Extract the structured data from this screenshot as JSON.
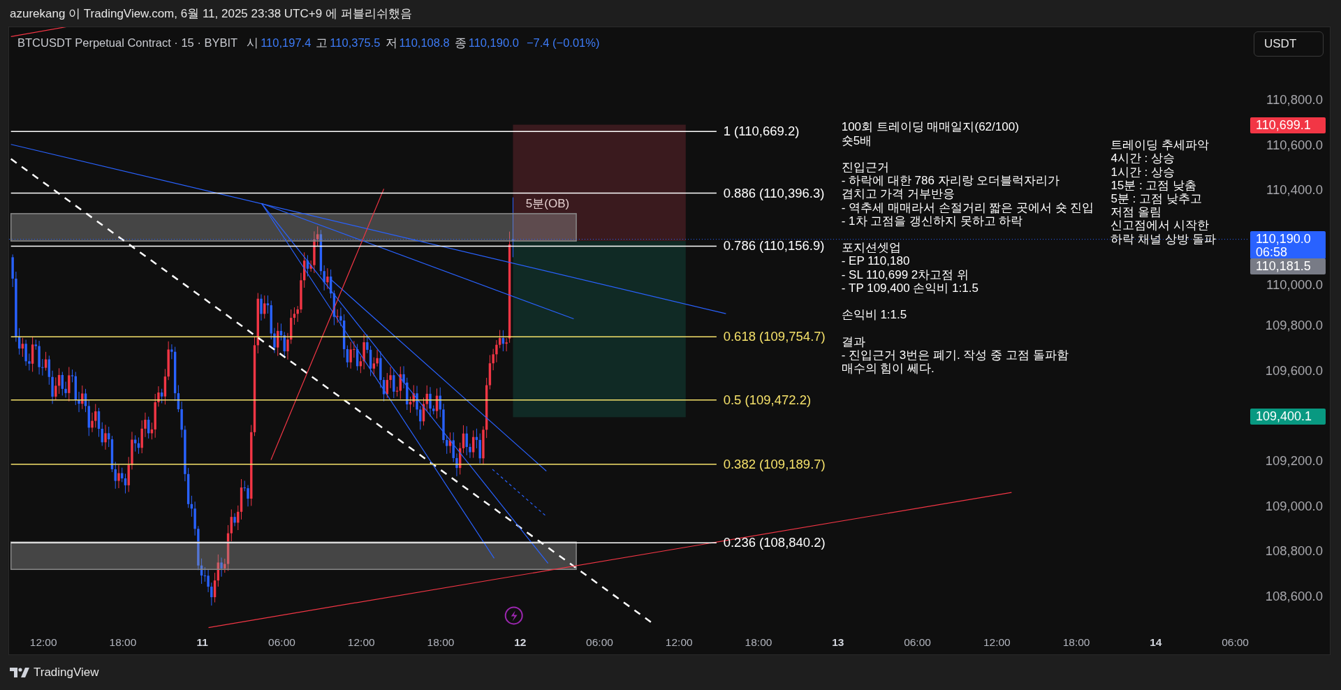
{
  "header": {
    "text": "azurekang 이 TradingView.com, 6월 11, 2025 23:38 UTC+9 에 퍼블리쉬했음"
  },
  "legend": {
    "symbol": "BTCUSDT Perpetual Contract · 15 · BYBIT",
    "fields": [
      {
        "label": "시",
        "value": "110,197.4"
      },
      {
        "label": "고",
        "value": "110,375.5"
      },
      {
        "label": "저",
        "value": "110,108.8"
      },
      {
        "label": "종",
        "value": "110,190.0"
      }
    ],
    "change": "−7.4 (−0.01%)"
  },
  "currency_button": "USDT",
  "fib_levels": [
    {
      "label": "1 (110,669.2)",
      "color": "#ffffff"
    },
    {
      "label": "0.886 (110,396.3)",
      "color": "#ffffff"
    },
    {
      "label": "0.786 (110,156.9)",
      "color": "#ffffff"
    },
    {
      "label": "0.618 (109,754.7)",
      "color": "#f5e16a"
    },
    {
      "label": "0.5 (109,472.2)",
      "color": "#f5e16a"
    },
    {
      "label": "0.382 (109,189.7)",
      "color": "#f5e16a"
    },
    {
      "label": "0.236 (108,840.2)",
      "color": "#ffffff"
    }
  ],
  "zone_label": "5분(OB)",
  "notes": [
    {
      "text": "100회 트레이딩 매매일지(62/100)\n숏5배\n\n진입근거\n- 하락에 대한 786 자리랑 오더블럭자리가\n겹치고 가격 거부반응\n- 역추세 매매라서 손절거리 짧은 곳에서 숏 진입\n- 1차 고점을 갱신하지 못하고 하락\n\n포지션셋업\n- EP 110,180\n- SL 110,699 2차고점 위\n- TP 109,400 손익비 1:1.5\n\n손익비 1:1.5\n\n결과\n- 진입근거 3번은 폐기. 작성 중 고점 돌파함\n매수의 힘이 쎄다."
    },
    {
      "text": "트레이딩 추세파악\n4시간 : 상승\n1시간 : 상승\n15분 : 고점 낮춤\n5분 : 고점 낮추고\n저점 올림\n신고점에서 시작한\n하락 채널 상방 돌파"
    }
  ],
  "price_axis": {
    "ticks": [
      "110,800.0",
      "110,600.0",
      "110,400.0",
      "110,000.0",
      "109,800.0",
      "109,600.0",
      "109,200.0",
      "109,000.0",
      "108,800.0",
      "108,600.0"
    ],
    "tags": [
      {
        "kind": "stop",
        "text": "110,699.1",
        "color": "#f23645"
      },
      {
        "kind": "last",
        "text": "110,190.0",
        "countdown": "06:58",
        "color": "#2962ff"
      },
      {
        "kind": "entry",
        "text": "110,181.5",
        "color": "#787b86"
      },
      {
        "kind": "target",
        "text": "109,400.1",
        "color": "#089981"
      }
    ]
  },
  "time_axis": [
    {
      "label": "12:00",
      "kind": "time"
    },
    {
      "label": "18:00",
      "kind": "time"
    },
    {
      "label": "11",
      "kind": "day"
    },
    {
      "label": "06:00",
      "kind": "time"
    },
    {
      "label": "12:00",
      "kind": "time"
    },
    {
      "label": "18:00",
      "kind": "time"
    },
    {
      "label": "12",
      "kind": "day"
    },
    {
      "label": "06:00",
      "kind": "time"
    },
    {
      "label": "12:00",
      "kind": "time"
    },
    {
      "label": "18:00",
      "kind": "time"
    },
    {
      "label": "13",
      "kind": "day"
    },
    {
      "label": "06:00",
      "kind": "time"
    },
    {
      "label": "12:00",
      "kind": "time"
    },
    {
      "label": "18:00",
      "kind": "time"
    },
    {
      "label": "14",
      "kind": "day"
    },
    {
      "label": "06:00",
      "kind": "time"
    }
  ],
  "footer": {
    "brand": "TradingView"
  }
}
